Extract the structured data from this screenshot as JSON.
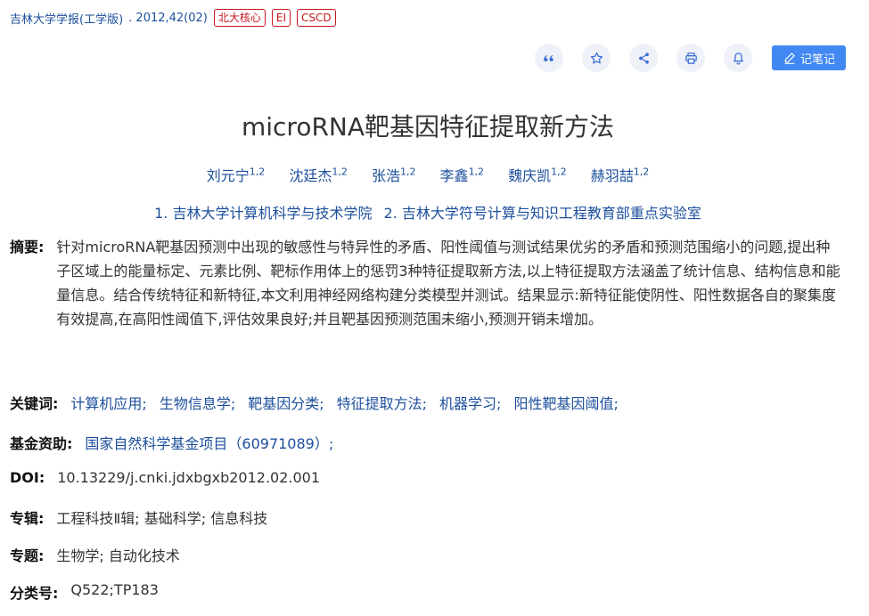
{
  "journal": {
    "name": "吉林大学学报(工学版)",
    "issue": ". 2012,42(02)",
    "badges": [
      "北大核心",
      "EI",
      "CSCD"
    ]
  },
  "toolbar": {
    "icons": [
      "quote-icon",
      "star-icon",
      "share-icon",
      "print-icon",
      "bell-icon"
    ],
    "note_label": "记笔记"
  },
  "article": {
    "title": "microRNA靶基因特征提取新方法",
    "authors": [
      {
        "name": "刘元宁",
        "sup": "1,2"
      },
      {
        "name": "沈廷杰",
        "sup": "1,2"
      },
      {
        "name": "张浩",
        "sup": "1,2"
      },
      {
        "name": "李鑫",
        "sup": "1,2"
      },
      {
        "name": "魏庆凯",
        "sup": "1,2"
      },
      {
        "name": "赫羽喆",
        "sup": "1,2"
      }
    ],
    "orgs": [
      "1. 吉林大学计算机科学与技术学院",
      "2. 吉林大学符号计算与知识工程教育部重点实验室"
    ]
  },
  "abstract": {
    "label": "摘要:",
    "text": "针对microRNA靶基因预测中出现的敏感性与特异性的矛盾、阳性阈值与测试结果优劣的矛盾和预测范围缩小的问题,提出种子区域上的能量标定、元素比例、靶标作用体上的惩罚3种特征提取新方法,以上特征提取方法涵盖了统计信息、结构信息和能量信息。结合传统特征和新特征,本文利用神经网络构建分类模型并测试。结果显示:新特征能使阴性、阳性数据各自的聚集度有效提高,在高阳性阈值下,评估效果良好;并且靶基因预测范围未缩小,预测开销未增加。"
  },
  "keywords": {
    "label": "关键词:",
    "items": [
      "计算机应用;",
      "生物信息学;",
      "靶基因分类;",
      "特征提取方法;",
      "机器学习;",
      "阳性靶基因阈值;"
    ]
  },
  "fund": {
    "label": "基金资助:",
    "value": "国家自然科学基金项目（60971089）;"
  },
  "doi": {
    "label": "DOI:",
    "value": "10.13229/j.cnki.jdxbgxb2012.02.001"
  },
  "series": {
    "label": "专辑:",
    "value": "工程科技Ⅱ辑; 基础科学; 信息科技"
  },
  "topic": {
    "label": "专题:",
    "value": "生物学; 自动化技术"
  },
  "classno": {
    "label": "分类号:",
    "value": "Q522;TP183"
  },
  "colors": {
    "link": "#1c4f9c",
    "badge": "#c8161d",
    "button": "#4188f2"
  }
}
